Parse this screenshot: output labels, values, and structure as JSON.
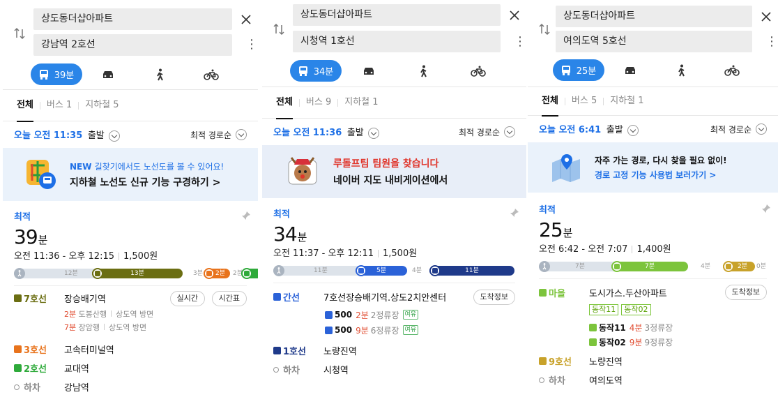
{
  "panels": [
    {
      "origin": "상도동더샵아파트",
      "destination": "강남역 2호선",
      "mode_time": "39분",
      "tabs": [
        "전체",
        "버스 1",
        "지하철 5"
      ],
      "departure_prefix": "오늘 오전 11:35",
      "departure_suffix": "출발",
      "sort": "최적 경로순",
      "banner_line1_tag": "NEW",
      "banner_line1": "길찾기에서도 노선도를 볼 수 있어요!",
      "banner_line2": "지하철 노선도 신규 기능 구경하기 >",
      "best_label": "최적",
      "total_num": "39",
      "total_unit": "분",
      "time_range": "오전 11:36 - 오후 12:15",
      "fare": "1,500원",
      "bar": {
        "w1": "12분",
        "seg1": "13분",
        "w2": "3분",
        "seg2": "2분",
        "w3": "2분"
      },
      "steps": {
        "s1_tag": "7호선",
        "s1_name": "장승배기역",
        "s1_btn1": "실시간",
        "s1_btn2": "시간표",
        "s1_sub1_time": "2분",
        "s1_sub1_dir": "도봉산행",
        "s1_sub1_way": "상도역 방면",
        "s1_sub2_time": "7분",
        "s1_sub2_dir": "장암행",
        "s1_sub2_way": "상도역 방면",
        "s2_tag": "3호선",
        "s2_name": "고속터미널역",
        "s3_tag": "2호선",
        "s3_name": "교대역",
        "s4_tag": "하차",
        "s4_name": "강남역"
      }
    },
    {
      "origin": "상도동더샵아파트",
      "destination": "시청역 1호선",
      "mode_time": "34분",
      "tabs": [
        "전체",
        "버스 9",
        "지하철 1"
      ],
      "departure_prefix": "오늘 오전 11:36",
      "departure_suffix": "출발",
      "sort": "최적 경로순",
      "banner_line1": "루돌프팀 팀원을 찾습니다",
      "banner_line2": "네이버 지도 내비게이션에서",
      "best_label": "최적",
      "total_num": "34",
      "total_unit": "분",
      "time_range": "오전 11:37 - 오후 12:11",
      "fare": "1,500원",
      "bar": {
        "w1": "11분",
        "seg1": "5분",
        "w2": "4분",
        "seg2": "11분"
      },
      "steps": {
        "s1_tag": "간선",
        "s1_name": "7호선장승배기역.상도2치안센터",
        "s1_btn": "도착정보",
        "bus1_no": "500",
        "bus1_time": "2분",
        "bus1_stops": "2정류장",
        "bus1_tag": "여유",
        "bus2_no": "500",
        "bus2_time": "9분",
        "bus2_stops": "6정류장",
        "bus2_tag": "여유",
        "s2_tag": "1호선",
        "s2_name": "노량진역",
        "s3_tag": "하차",
        "s3_name": "시청역"
      }
    },
    {
      "origin": "상도동더샵아파트",
      "destination": "여의도역 5호선",
      "mode_time": "25분",
      "tabs": [
        "전체",
        "버스 5",
        "지하철 1"
      ],
      "departure_prefix": "오늘 오전 6:41",
      "departure_suffix": "출발",
      "sort": "최적 경로순",
      "banner_line1": "자주 가는 경로, 다시 찾을 필요 없이!",
      "banner_line2": "경로 고정 기능 사용법 보러가기 >",
      "best_label": "최적",
      "total_num": "25",
      "total_unit": "분",
      "time_range": "오전 6:42 - 오전 7:07",
      "fare": "1,400원",
      "bar": {
        "w1": "7분",
        "seg1": "7분",
        "w2": "4분",
        "seg2": "2분",
        "w3": "0분"
      },
      "steps": {
        "s1_tag": "마을",
        "s1_name": "도시가스.두산아파트",
        "s1_btn": "도착정보",
        "chip1": "동작11",
        "chip2": "동작02",
        "bus1_no": "동작11",
        "bus1_time": "4분",
        "bus1_stops": "3정류장",
        "bus2_no": "동작02",
        "bus2_time": "9분",
        "bus2_stops": "9정류장",
        "s2_tag": "9호선",
        "s2_name": "노량진역",
        "s3_tag": "하차",
        "s3_name": "여의도역"
      }
    }
  ],
  "colors": {
    "accent": "#2a85e8",
    "line7": "#6b6e12",
    "line3": "#e8731c",
    "line2": "#2eaa3a",
    "trunk_bus": "#2b62d8",
    "line1": "#1f3a8a",
    "village_bus": "#7cc43c",
    "line9": "#c8a22a",
    "red_time": "#e04a2e"
  }
}
